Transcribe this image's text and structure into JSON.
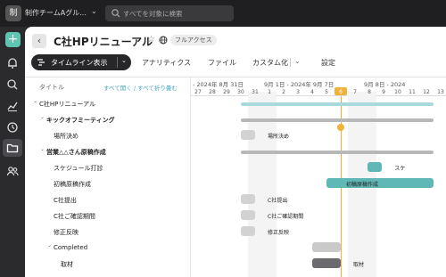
{
  "workspace": {
    "avatar": "制",
    "name": "制作チームAグル..."
  },
  "search": {
    "placeholder": "すべてを対象に検索"
  },
  "project": {
    "title": "C社HPリニューアル",
    "access": "フルアクセス"
  },
  "toolbar": {
    "view_label": "タイムライン表示",
    "tabs": [
      "アナリティクス",
      "ファイル",
      "カスタム化",
      "設定"
    ]
  },
  "list": {
    "column_title": "タイトル",
    "expand_link": "すべて開く / すべて折り畳む",
    "rows": [
      {
        "label": "C社HPリニューアル",
        "bold": false,
        "level": 0,
        "caret": true
      },
      {
        "label": "キックオフミーティング",
        "bold": true,
        "level": 1,
        "caret": true
      },
      {
        "label": "場所決め",
        "bold": false,
        "level": 2,
        "caret": false
      },
      {
        "label": "営業△△さん原稿作成",
        "bold": true,
        "level": 1,
        "caret": true
      },
      {
        "label": "スケジュール打診",
        "bold": false,
        "level": 2,
        "caret": false
      },
      {
        "label": "初稿原稿作成",
        "bold": false,
        "level": 2,
        "caret": false
      },
      {
        "label": "C社提出",
        "bold": false,
        "level": 2,
        "caret": false
      },
      {
        "label": "C社ご確認期間",
        "bold": false,
        "level": 2,
        "caret": false
      },
      {
        "label": "修正反映",
        "bold": false,
        "level": 2,
        "caret": false
      },
      {
        "label": "Completed",
        "bold": false,
        "level": 2,
        "caret": true
      },
      {
        "label": "取材",
        "bold": false,
        "level": 3,
        "caret": false
      }
    ]
  },
  "timeline": {
    "months": [
      {
        "label": "- 2024年 8月 31日",
        "at": 0
      },
      {
        "label": "9月 1日 - 2024年 9月 7日",
        "at": 5
      },
      {
        "label": "9月 8日 - 2024",
        "at": 12
      }
    ],
    "days": [
      "27",
      "28",
      "29",
      "30",
      "31",
      "1",
      "2",
      "3",
      "4",
      "5",
      "6",
      "7",
      "8",
      "9",
      "10",
      "11",
      "12",
      "13"
    ],
    "weekend_index": [
      4,
      5,
      11,
      12
    ],
    "today_index": 10,
    "bars": [
      {
        "row": 0,
        "start": 3.5,
        "end": 17,
        "color": "#a9d9dd",
        "label": ""
      },
      {
        "row": 1,
        "start": 3.5,
        "end": 17,
        "color": "#b8b8b8",
        "label": ""
      },
      {
        "row": 2,
        "start": 3.5,
        "end": 4.5,
        "color": "#d2d2d2",
        "label": "場所決め"
      },
      {
        "row": 3,
        "start": 3.5,
        "end": 17,
        "color": "#b8b8b8",
        "label": ""
      },
      {
        "row": 4,
        "start": 12.4,
        "end": 13.4,
        "color": "#5fb7b6",
        "label": "スケ"
      },
      {
        "row": 5,
        "start": 9.5,
        "end": 17,
        "color": "#5fb7b6",
        "label": "初稿原稿作成"
      },
      {
        "row": 6,
        "start": 3.5,
        "end": 4.5,
        "color": "#d2d2d2",
        "label": "C社提出"
      },
      {
        "row": 7,
        "start": 3.5,
        "end": 4.5,
        "color": "#d2d2d2",
        "label": "C社ご確認期間"
      },
      {
        "row": 8,
        "start": 3.5,
        "end": 4.5,
        "color": "#d2d2d2",
        "label": "修正反映"
      },
      {
        "row": 9,
        "start": 8.5,
        "end": 10.5,
        "color": "#c9c9c9",
        "label": ""
      },
      {
        "row": 10,
        "start": 8.5,
        "end": 10.5,
        "color": "#6b6b6f",
        "label": "取材"
      }
    ]
  },
  "colors": {
    "accent": "#5fc4b0",
    "today": "#f0b23b",
    "link": "#4aa8c4"
  }
}
